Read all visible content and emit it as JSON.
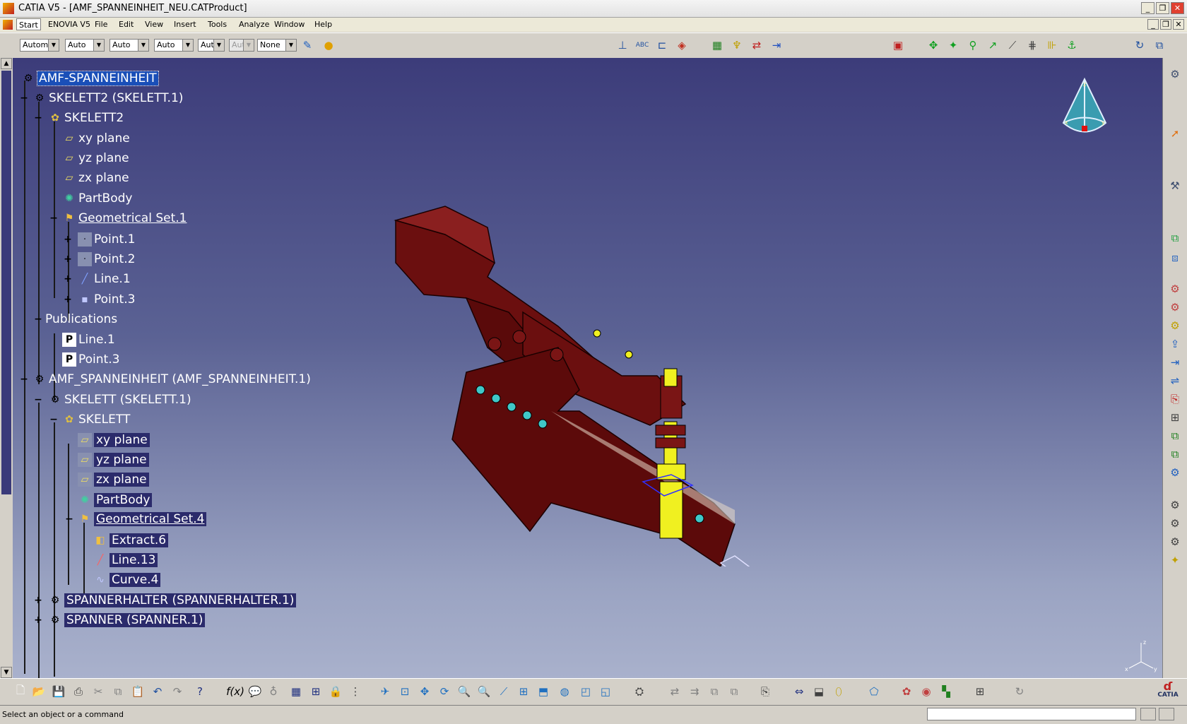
{
  "window": {
    "title": "CATIA V5 - [AMF_SPANNEINHEIT_NEU.CATProduct]",
    "controls": [
      "_",
      "❐",
      "✕"
    ],
    "doc_controls": [
      "_",
      "❐",
      "✕"
    ]
  },
  "menu": {
    "items": [
      "Start",
      "ENOVIA V5",
      "File",
      "Edit",
      "View",
      "Insert",
      "Tools",
      "Analyze",
      "Window",
      "Help"
    ]
  },
  "toolbar": {
    "combos": [
      "Automa",
      "Auto",
      "Auto",
      "Auto",
      "Aut",
      "Aut",
      "None"
    ]
  },
  "tree": {
    "nodes": [
      {
        "label": "AMF-SPANNEINHEIT",
        "icon": "product-icon",
        "style": "sel"
      },
      {
        "label": "SKELETT2 (SKELETT.1)",
        "icon": "component-icon",
        "style": ""
      },
      {
        "label": "SKELETT2",
        "icon": "part-icon",
        "style": ""
      },
      {
        "label": "xy plane",
        "icon": "plane-icon",
        "style": ""
      },
      {
        "label": "yz plane",
        "icon": "plane-icon",
        "style": ""
      },
      {
        "label": "zx plane",
        "icon": "plane-icon",
        "style": ""
      },
      {
        "label": "PartBody",
        "icon": "body-icon",
        "style": ""
      },
      {
        "label": "Geometrical Set.1",
        "icon": "geoset-icon",
        "style": "u"
      },
      {
        "label": "Point.1",
        "icon": "point-icon",
        "style": ""
      },
      {
        "label": "Point.2",
        "icon": "point-icon",
        "style": ""
      },
      {
        "label": "Line.1",
        "icon": "line-icon",
        "style": ""
      },
      {
        "label": "Point.3",
        "icon": "point-icon",
        "style": ""
      },
      {
        "label": "Publications",
        "icon": "",
        "style": ""
      },
      {
        "label": "Line.1",
        "icon": "publication-icon",
        "style": ""
      },
      {
        "label": "Point.3",
        "icon": "publication-icon",
        "style": ""
      },
      {
        "label": "AMF_SPANNEINHEIT (AMF_SPANNEINHEIT.1)",
        "icon": "component-icon",
        "style": ""
      },
      {
        "label": "SKELETT (SKELETT.1)",
        "icon": "component-icon",
        "style": ""
      },
      {
        "label": "SKELETT",
        "icon": "part-icon",
        "style": ""
      },
      {
        "label": "xy plane",
        "icon": "plane-icon",
        "style": "hl"
      },
      {
        "label": "yz plane",
        "icon": "plane-icon",
        "style": "hl"
      },
      {
        "label": "zx plane",
        "icon": "plane-icon",
        "style": "hl"
      },
      {
        "label": "PartBody",
        "icon": "body-icon",
        "style": "hl"
      },
      {
        "label": "Geometrical Set.4",
        "icon": "geoset-icon",
        "style": "u hl"
      },
      {
        "label": "Extract.6",
        "icon": "extract-icon",
        "style": "hl"
      },
      {
        "label": "Line.13",
        "icon": "line-icon",
        "style": "hl"
      },
      {
        "label": "Curve.4",
        "icon": "curve-icon",
        "style": "hl"
      },
      {
        "label": "SPANNERHALTER (SPANNERHALTER.1)",
        "icon": "component-icon",
        "style": "hl"
      },
      {
        "label": "SPANNER (SPANNER.1)",
        "icon": "component-icon",
        "style": "hl"
      }
    ]
  },
  "status": {
    "text": "Select an object or a command"
  },
  "compass": {
    "labels": [
      "x",
      "y",
      "z"
    ]
  },
  "axis": {
    "labels": [
      "x",
      "y",
      "z"
    ]
  },
  "brand": {
    "logo_text": "CATIA"
  }
}
